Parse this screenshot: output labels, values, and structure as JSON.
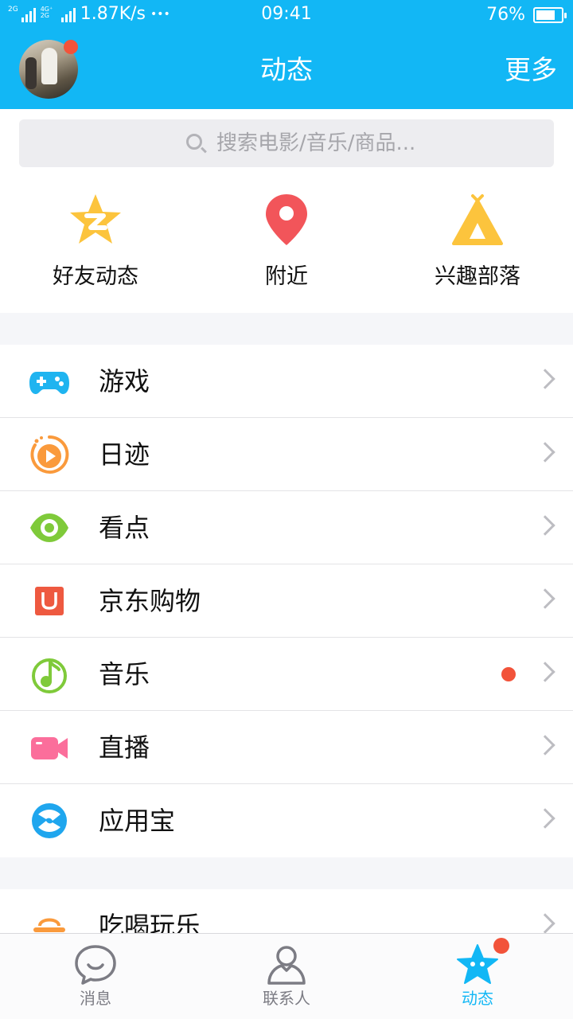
{
  "status_bar": {
    "signal_1": "2G",
    "signal_2": "4G⁺ 2G",
    "speed": "1.87K/s",
    "more": "•••",
    "time": "09:41",
    "battery": "76%",
    "battery_level": 0.76
  },
  "header": {
    "title": "动态",
    "more_label": "更多",
    "avatar_badge": true
  },
  "search": {
    "placeholder": "搜索电影/音乐/商品..."
  },
  "quick_entries": [
    {
      "label": "好友动态",
      "icon": "qzone-star-icon",
      "color": "#fcc43d"
    },
    {
      "label": "附近",
      "icon": "location-pin-icon",
      "color": "#f2555a"
    },
    {
      "label": "兴趣部落",
      "icon": "tent-icon",
      "color": "#fcc43d"
    }
  ],
  "menu_items": [
    {
      "label": "游戏",
      "icon": "gamepad-icon",
      "color": "#1fb4f0"
    },
    {
      "label": "日迹",
      "icon": "play-circle-icon",
      "color": "#fa9a3c"
    },
    {
      "label": "看点",
      "icon": "eye-icon",
      "color": "#7fca3a"
    },
    {
      "label": "京东购物",
      "icon": "jd-shopping-icon",
      "color": "#ee5940"
    },
    {
      "label": "音乐",
      "icon": "music-note-icon",
      "color": "#7fca3a",
      "badge": true
    },
    {
      "label": "直播",
      "icon": "video-camera-icon",
      "color": "#fb6e9b"
    },
    {
      "label": "应用宝",
      "icon": "app-store-icon",
      "color": "#1fa6ee"
    }
  ],
  "menu_items_2": [
    {
      "label": "吃喝玩乐",
      "icon": "food-bowl-icon",
      "color": "#fa9a3c"
    }
  ],
  "tab_bar": {
    "tabs": [
      {
        "label": "消息",
        "icon": "chat-bubble-icon",
        "active": false
      },
      {
        "label": "联系人",
        "icon": "contact-person-icon",
        "active": false
      },
      {
        "label": "动态",
        "icon": "star-icon",
        "active": true,
        "badge": true
      }
    ],
    "accent": "#12b7f5"
  }
}
